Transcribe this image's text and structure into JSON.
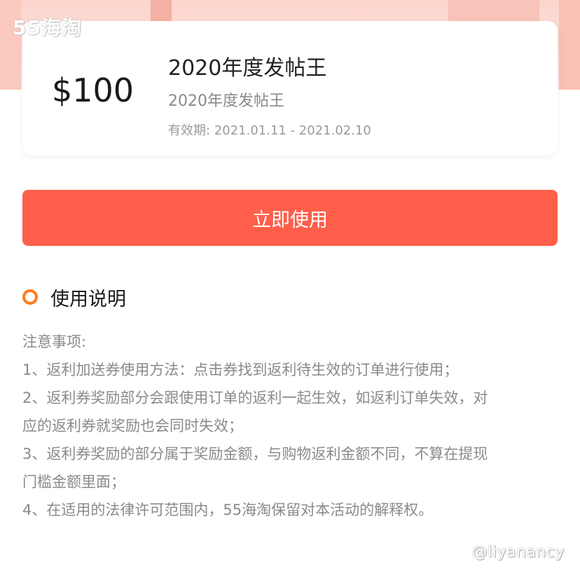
{
  "watermark": {
    "top": "55海淘",
    "bottom": "@liyanancy"
  },
  "coupon": {
    "amount": "$100",
    "title": "2020年度发帖王",
    "subtitle": "2020年度发帖王",
    "validity": "有效期: 2021.01.11 - 2021.02.10"
  },
  "action": {
    "use_label": "立即使用"
  },
  "instructions": {
    "title": "使用说明",
    "lines": [
      "注意事项:",
      "1、返利加送券使用方法：点击券找到返利待生效的订单进行使用；",
      "2、返利券奖励部分会跟使用订单的返利一起生效，如返利订单失效，对",
      "应的返利券就奖励也会同时失效；",
      "3、返利券奖励的部分属于奖励金额，与购物返利金额不同，不算在提现",
      "门槛金额里面；",
      "4、在适用的法律许可范围内，55海淘保留对本活动的解释权。"
    ]
  },
  "colors": {
    "accent": "#ff5f4a",
    "bullet": "#ff7a1a"
  }
}
